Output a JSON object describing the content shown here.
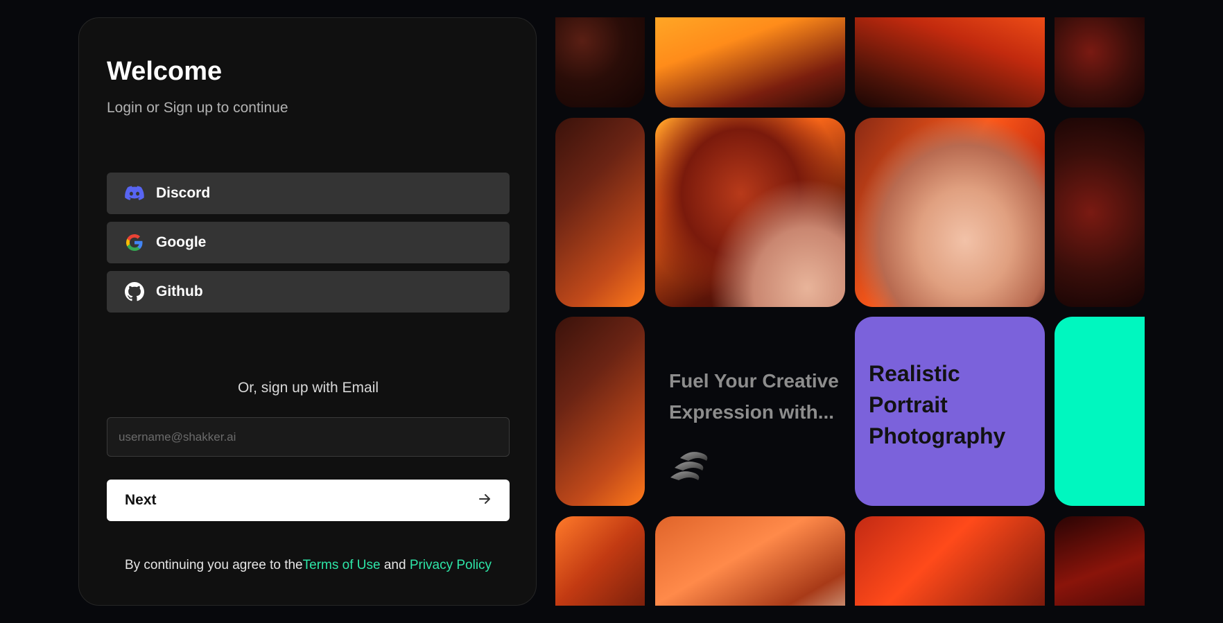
{
  "login": {
    "title": "Welcome",
    "subtitle": "Login or Sign up to continue",
    "providers": [
      {
        "label": "Discord",
        "icon": "discord-icon",
        "color": "#5865f2"
      },
      {
        "label": "Google",
        "icon": "google-icon"
      },
      {
        "label": "Github",
        "icon": "github-icon",
        "color": "#ffffff"
      }
    ],
    "divider": "Or, sign up with Email",
    "email": {
      "value": "",
      "placeholder": "username@shakker.ai"
    },
    "next_label": "Next",
    "next_icon": "arrow-right-icon",
    "terms": {
      "prefix": "By continuing you agree to the",
      "terms_link": "Terms of Use",
      "conjunction": " and ",
      "privacy_link": "Privacy Policy",
      "link_color": "#2ee6a8"
    }
  },
  "gallery": {
    "promo_text": "Fuel Your Creative Expression with...",
    "promo_icon": "shakker-logo-icon",
    "feature": {
      "line1": "Realistic",
      "line2": "Portrait",
      "line3": "Photography",
      "color": "#7b62db"
    },
    "accent_tile_color": "#00f7bf"
  },
  "colors": {
    "background": "#07080c",
    "panel": "#101010",
    "button": "#343434"
  }
}
